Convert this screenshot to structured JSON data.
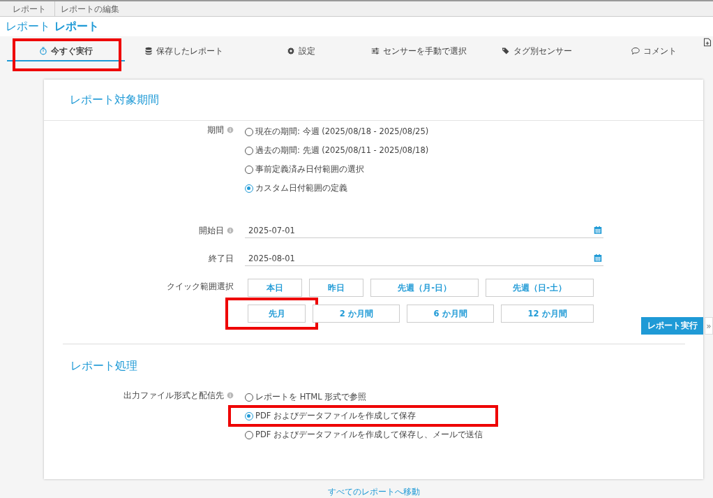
{
  "breadcrumb": [
    {
      "label": "レポート"
    },
    {
      "label": "レポートの編集"
    }
  ],
  "page_title": {
    "prefix": "レポート",
    "name": "レポート"
  },
  "tabs": [
    {
      "label": "今すぐ実行",
      "selected": true,
      "highlighted": true
    },
    {
      "label": "保存したレポート",
      "selected": false,
      "highlighted": false
    },
    {
      "label": "設定",
      "selected": false,
      "highlighted": false
    },
    {
      "label": "センサーを手動で選択",
      "selected": false,
      "highlighted": false
    },
    {
      "label": "タグ別センサー",
      "selected": false,
      "highlighted": false
    },
    {
      "label": "コメント",
      "selected": false,
      "highlighted": false
    }
  ],
  "period_section": {
    "title": "レポート対象期間",
    "period": {
      "label": "期間",
      "info": true,
      "options": [
        {
          "label": "現在の期間: 今週 (2025/08/18 - 2025/08/25)",
          "selected": false,
          "highlighted": false
        },
        {
          "label": "過去の期間: 先週 (2025/08/11 - 2025/08/18)",
          "selected": false,
          "highlighted": false
        },
        {
          "label": "事前定義済み日付範囲の選択",
          "selected": false,
          "highlighted": false
        },
        {
          "label": "カスタム日付範囲の定義",
          "selected": true,
          "highlighted": false
        }
      ]
    },
    "start_date": {
      "label": "開始日",
      "info": true,
      "value": "2025-07-01"
    },
    "end_date": {
      "label": "終了日",
      "info": false,
      "value": "2025-08-01"
    },
    "quick_range": {
      "label": "クイック範囲選択",
      "rows": [
        [
          {
            "label": "本日",
            "highlighted": false
          },
          {
            "label": "昨日",
            "highlighted": false
          },
          {
            "label": "先週（月-日）",
            "highlighted": false
          },
          {
            "label": "先週（日-土）",
            "highlighted": false
          }
        ],
        [
          {
            "label": "先月",
            "highlighted": true
          },
          {
            "label": "2 か月間",
            "highlighted": false
          },
          {
            "label": "6 か月間",
            "highlighted": false
          },
          {
            "label": "12 か月間",
            "highlighted": false
          }
        ]
      ]
    }
  },
  "run_button": {
    "label": "レポート実行",
    "more": "»"
  },
  "processing_section": {
    "title": "レポート処理",
    "output": {
      "label": "出力ファイル形式と配信先",
      "info": true,
      "options": [
        {
          "label": "レポートを HTML 形式で参照",
          "selected": false,
          "highlighted": false
        },
        {
          "label": "PDF およびデータファイルを作成して保存",
          "selected": true,
          "highlighted": true
        },
        {
          "label": "PDF およびデータファイルを作成して保存し、メールで送信",
          "selected": false,
          "highlighted": false
        }
      ]
    }
  },
  "footer_link": "すべてのレポートへ移動"
}
